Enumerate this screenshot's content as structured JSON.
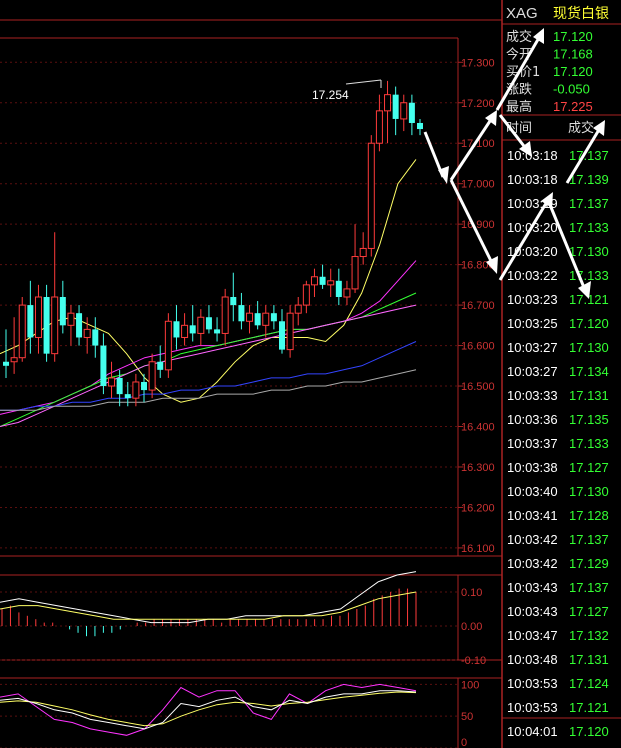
{
  "header": {
    "symbol": "XAG",
    "name": "现货白银"
  },
  "quote": {
    "rows": [
      {
        "label": "成交",
        "value": "17.120",
        "color": "#33ff33"
      },
      {
        "label": "今开",
        "value": "17.168",
        "color": "#33ff33"
      },
      {
        "label": "买价1",
        "value": "17.120",
        "color": "#33ff33"
      },
      {
        "label": "涨跌",
        "value": "-0.050",
        "color": "#33ff33"
      },
      {
        "label": "最高",
        "value": "17.225",
        "color": "#ff4444"
      }
    ]
  },
  "ticks": {
    "col_time": "时间",
    "col_price": "成交",
    "rows": [
      {
        "time": "10:03:18",
        "price": "17.137"
      },
      {
        "time": "10:03:18",
        "price": "17.139"
      },
      {
        "time": "10:03:19",
        "price": "17.137"
      },
      {
        "time": "10:03:20",
        "price": "17.133"
      },
      {
        "time": "10:03:20",
        "price": "17.130"
      },
      {
        "time": "10:03:22",
        "price": "17.133"
      },
      {
        "time": "10:03:23",
        "price": "17.121"
      },
      {
        "time": "10:03:25",
        "price": "17.120"
      },
      {
        "time": "10:03:27",
        "price": "17.130"
      },
      {
        "time": "10:03:27",
        "price": "17.134"
      },
      {
        "time": "10:03:33",
        "price": "17.131"
      },
      {
        "time": "10:03:36",
        "price": "17.135"
      },
      {
        "time": "10:03:37",
        "price": "17.133"
      },
      {
        "time": "10:03:38",
        "price": "17.127"
      },
      {
        "time": "10:03:40",
        "price": "17.130"
      },
      {
        "time": "10:03:41",
        "price": "17.128"
      },
      {
        "time": "10:03:42",
        "price": "17.137"
      },
      {
        "time": "10:03:42",
        "price": "17.129"
      },
      {
        "time": "10:03:43",
        "price": "17.137"
      },
      {
        "time": "10:03:43",
        "price": "17.127"
      },
      {
        "time": "10:03:47",
        "price": "17.132"
      },
      {
        "time": "10:03:48",
        "price": "17.131"
      },
      {
        "time": "10:03:53",
        "price": "17.124"
      },
      {
        "time": "10:03:53",
        "price": "17.121"
      },
      {
        "time": "10:04:01",
        "price": "17.120"
      }
    ]
  },
  "chart_data": {
    "type": "candlestick",
    "price_axis": {
      "ylim": [
        16.08,
        17.36
      ],
      "ticks": [
        "17.300",
        "17.200",
        "17.100",
        "17.000",
        "16.900",
        "16.800",
        "16.700",
        "16.600",
        "16.500",
        "16.400",
        "16.300",
        "16.200",
        "16.100"
      ]
    },
    "high_annotation": "17.254",
    "candles": [
      {
        "o": 16.56,
        "h": 16.64,
        "l": 16.52,
        "c": 16.55
      },
      {
        "o": 16.56,
        "h": 16.67,
        "l": 16.53,
        "c": 16.57
      },
      {
        "o": 16.57,
        "h": 16.72,
        "l": 16.56,
        "c": 16.7
      },
      {
        "o": 16.7,
        "h": 16.76,
        "l": 16.58,
        "c": 16.62
      },
      {
        "o": 16.62,
        "h": 16.75,
        "l": 16.58,
        "c": 16.72
      },
      {
        "o": 16.72,
        "h": 16.75,
        "l": 16.56,
        "c": 16.58
      },
      {
        "o": 16.58,
        "h": 16.88,
        "l": 16.56,
        "c": 16.72
      },
      {
        "o": 16.72,
        "h": 16.76,
        "l": 16.63,
        "c": 16.65
      },
      {
        "o": 16.65,
        "h": 16.7,
        "l": 16.6,
        "c": 16.68
      },
      {
        "o": 16.68,
        "h": 16.7,
        "l": 16.6,
        "c": 16.62
      },
      {
        "o": 16.62,
        "h": 16.67,
        "l": 16.58,
        "c": 16.64
      },
      {
        "o": 16.64,
        "h": 16.67,
        "l": 16.57,
        "c": 16.6
      },
      {
        "o": 16.6,
        "h": 16.63,
        "l": 16.48,
        "c": 16.5
      },
      {
        "o": 16.5,
        "h": 16.56,
        "l": 16.47,
        "c": 16.52
      },
      {
        "o": 16.52,
        "h": 16.54,
        "l": 16.45,
        "c": 16.48
      },
      {
        "o": 16.48,
        "h": 16.51,
        "l": 16.45,
        "c": 16.47
      },
      {
        "o": 16.47,
        "h": 16.53,
        "l": 16.45,
        "c": 16.51
      },
      {
        "o": 16.51,
        "h": 16.53,
        "l": 16.46,
        "c": 16.49
      },
      {
        "o": 16.49,
        "h": 16.58,
        "l": 16.47,
        "c": 16.56
      },
      {
        "o": 16.56,
        "h": 16.6,
        "l": 16.52,
        "c": 16.54
      },
      {
        "o": 16.54,
        "h": 16.68,
        "l": 16.52,
        "c": 16.66
      },
      {
        "o": 16.66,
        "h": 16.7,
        "l": 16.59,
        "c": 16.62
      },
      {
        "o": 16.62,
        "h": 16.68,
        "l": 16.6,
        "c": 16.65
      },
      {
        "o": 16.65,
        "h": 16.7,
        "l": 16.61,
        "c": 16.63
      },
      {
        "o": 16.63,
        "h": 16.69,
        "l": 16.6,
        "c": 16.67
      },
      {
        "o": 16.67,
        "h": 16.7,
        "l": 16.63,
        "c": 16.64
      },
      {
        "o": 16.64,
        "h": 16.67,
        "l": 16.61,
        "c": 16.63
      },
      {
        "o": 16.63,
        "h": 16.74,
        "l": 16.6,
        "c": 16.72
      },
      {
        "o": 16.72,
        "h": 16.78,
        "l": 16.66,
        "c": 16.7
      },
      {
        "o": 16.7,
        "h": 16.73,
        "l": 16.64,
        "c": 16.66
      },
      {
        "o": 16.66,
        "h": 16.7,
        "l": 16.63,
        "c": 16.68
      },
      {
        "o": 16.68,
        "h": 16.71,
        "l": 16.64,
        "c": 16.65
      },
      {
        "o": 16.65,
        "h": 16.7,
        "l": 16.62,
        "c": 16.68
      },
      {
        "o": 16.68,
        "h": 16.7,
        "l": 16.64,
        "c": 16.66
      },
      {
        "o": 16.66,
        "h": 16.69,
        "l": 16.58,
        "c": 16.59
      },
      {
        "o": 16.59,
        "h": 16.7,
        "l": 16.57,
        "c": 16.68
      },
      {
        "o": 16.68,
        "h": 16.72,
        "l": 16.65,
        "c": 16.7
      },
      {
        "o": 16.7,
        "h": 16.76,
        "l": 16.68,
        "c": 16.75
      },
      {
        "o": 16.75,
        "h": 16.79,
        "l": 16.72,
        "c": 16.77
      },
      {
        "o": 16.77,
        "h": 16.8,
        "l": 16.74,
        "c": 16.75
      },
      {
        "o": 16.75,
        "h": 16.79,
        "l": 16.72,
        "c": 16.76
      },
      {
        "o": 16.76,
        "h": 16.79,
        "l": 16.7,
        "c": 16.72
      },
      {
        "o": 16.72,
        "h": 16.76,
        "l": 16.7,
        "c": 16.74
      },
      {
        "o": 16.74,
        "h": 16.9,
        "l": 16.73,
        "c": 16.82
      },
      {
        "o": 16.82,
        "h": 16.88,
        "l": 16.8,
        "c": 16.84
      },
      {
        "o": 16.84,
        "h": 17.12,
        "l": 16.82,
        "c": 17.1
      },
      {
        "o": 17.1,
        "h": 17.22,
        "l": 17.08,
        "c": 17.18
      },
      {
        "o": 17.18,
        "h": 17.254,
        "l": 17.1,
        "c": 17.22
      },
      {
        "o": 17.22,
        "h": 17.24,
        "l": 17.12,
        "c": 17.16
      },
      {
        "o": 17.16,
        "h": 17.22,
        "l": 17.13,
        "c": 17.2
      },
      {
        "o": 17.2,
        "h": 17.22,
        "l": 17.12,
        "c": 17.15
      },
      {
        "o": 17.15,
        "h": 17.16,
        "l": 17.12,
        "c": 17.135
      }
    ],
    "ma_lines": [
      {
        "color": "#ffff66",
        "points": [
          16.58,
          16.6,
          16.63,
          16.66,
          16.67,
          16.65,
          16.63,
          16.58,
          16.52,
          16.48,
          16.46,
          16.47,
          16.51,
          16.56,
          16.6,
          16.62,
          16.62,
          16.62,
          16.61,
          16.65,
          16.73,
          16.85,
          17.0,
          17.06
        ]
      },
      {
        "color": "#ff33ff",
        "points": [
          16.43,
          16.44,
          16.45,
          16.46,
          16.48,
          16.5,
          16.53,
          16.55,
          16.57,
          16.58,
          16.59,
          16.6,
          16.6,
          16.61,
          16.62,
          16.63,
          16.64,
          16.64,
          16.65,
          16.66,
          16.68,
          16.71,
          16.76,
          16.81
        ]
      },
      {
        "color": "#33ff33",
        "points": [
          16.4,
          16.42,
          16.44,
          16.46,
          16.48,
          16.5,
          16.52,
          16.53,
          16.55,
          16.56,
          16.58,
          16.59,
          16.6,
          16.61,
          16.62,
          16.63,
          16.64,
          16.64,
          16.65,
          16.66,
          16.67,
          16.69,
          16.71,
          16.73
        ]
      },
      {
        "color": "#ff66ff",
        "points": [
          16.4,
          16.41,
          16.43,
          16.45,
          16.47,
          16.49,
          16.51,
          16.53,
          16.55,
          16.56,
          16.57,
          16.58,
          16.59,
          16.6,
          16.61,
          16.62,
          16.63,
          16.64,
          16.65,
          16.66,
          16.67,
          16.68,
          16.69,
          16.7
        ]
      },
      {
        "color": "#3344ff",
        "points": [
          16.44,
          16.44,
          16.45,
          16.45,
          16.46,
          16.46,
          16.47,
          16.47,
          16.48,
          16.48,
          16.49,
          16.49,
          16.5,
          16.5,
          16.51,
          16.52,
          16.52,
          16.53,
          16.53,
          16.54,
          16.55,
          16.57,
          16.59,
          16.61
        ]
      },
      {
        "color": "#aaaaaa",
        "points": [
          16.44,
          16.44,
          16.44,
          16.45,
          16.45,
          16.45,
          16.46,
          16.46,
          16.46,
          16.47,
          16.47,
          16.47,
          16.48,
          16.48,
          16.48,
          16.49,
          16.49,
          16.5,
          16.5,
          16.51,
          16.51,
          16.52,
          16.53,
          16.54
        ]
      }
    ],
    "macd_panel": {
      "ylim": [
        -0.1,
        0.15
      ],
      "ticks": [
        "0.10",
        "0.00",
        "-0.10"
      ],
      "bars": [
        0.05,
        0.06,
        0.04,
        0.03,
        0.02,
        0.01,
        0.01,
        0.0,
        -0.01,
        -0.02,
        -0.03,
        -0.03,
        -0.02,
        -0.02,
        -0.01,
        0.0,
        0.01,
        0.01,
        0.02,
        0.02,
        0.02,
        0.02,
        0.02,
        0.02,
        0.02,
        0.02,
        0.01,
        0.02,
        0.02,
        0.02,
        0.02,
        0.02,
        0.02,
        0.02,
        0.02,
        0.02,
        0.02,
        0.02,
        0.02,
        0.03,
        0.03,
        0.04,
        0.05,
        0.06,
        0.08,
        0.09,
        0.1,
        0.11,
        0.11,
        0.1
      ],
      "dif": [
        0.07,
        0.08,
        0.07,
        0.06,
        0.05,
        0.04,
        0.03,
        0.02,
        0.01,
        0.01,
        0.01,
        0.02,
        0.02,
        0.03,
        0.03,
        0.03,
        0.03,
        0.04,
        0.05,
        0.09,
        0.13,
        0.15,
        0.16
      ],
      "dea": [
        0.05,
        0.06,
        0.06,
        0.05,
        0.04,
        0.03,
        0.02,
        0.02,
        0.02,
        0.02,
        0.02,
        0.02,
        0.02,
        0.02,
        0.02,
        0.03,
        0.03,
        0.03,
        0.04,
        0.06,
        0.08,
        0.09,
        0.1
      ]
    },
    "kdj_panel": {
      "ylim": [
        0,
        110
      ],
      "ticks": [
        "100",
        "50",
        "0"
      ],
      "k": [
        75,
        78,
        70,
        60,
        55,
        45,
        40,
        35,
        30,
        40,
        70,
        65,
        75,
        80,
        65,
        60,
        75,
        70,
        80,
        85,
        85,
        90,
        90,
        88
      ],
      "d": [
        72,
        74,
        72,
        66,
        60,
        52,
        45,
        40,
        35,
        38,
        50,
        60,
        68,
        72,
        70,
        66,
        70,
        72,
        76,
        80,
        83,
        86,
        88,
        87
      ],
      "j": [
        80,
        85,
        65,
        45,
        40,
        30,
        25,
        20,
        30,
        60,
        95,
        80,
        90,
        90,
        55,
        45,
        85,
        70,
        90,
        100,
        95,
        100,
        95,
        90
      ]
    }
  }
}
